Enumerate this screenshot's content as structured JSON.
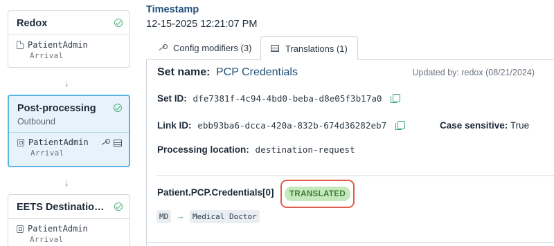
{
  "pipeline": [
    {
      "title": "Redox",
      "subtitle": "",
      "entity": "PatientAdmin",
      "event": "Arrival",
      "selected": false
    },
    {
      "title": "Post-processing",
      "subtitle": "Outbound",
      "entity": "PatientAdmin",
      "event": "Arrival",
      "selected": true
    },
    {
      "title": "EETS Destination ...",
      "subtitle": "",
      "entity": "PatientAdmin",
      "event": "Arrival",
      "selected": false
    }
  ],
  "arrow_glyph": "↓",
  "timestamp": {
    "label": "Timestamp",
    "value": "12-15-2025 12:21:07 PM"
  },
  "tabs": [
    {
      "label": "Config modifiers (3)",
      "icon": "wrench-icon",
      "active": false
    },
    {
      "label": "Translations (1)",
      "icon": "table-icon",
      "active": true
    }
  ],
  "set": {
    "name_label": "Set name:",
    "name_value": "PCP Credentials",
    "updated": "Updated by: redox (08/21/2024)",
    "set_id_label": "Set ID:",
    "set_id": "dfe7381f-4c94-4bd0-beba-d8e05f3b17a0",
    "link_id_label": "Link ID:",
    "link_id": "ebb93ba6-dcca-420a-832b-674d36282eb7",
    "case_label": "Case sensitive:",
    "case_value": "True",
    "location_label": "Processing location:",
    "location_value": "destination-request"
  },
  "translation": {
    "path": "Patient.PCP.Credentials[0]",
    "status": "TRANSLATED",
    "from": "MD",
    "arrow": "→",
    "to": "Medical Doctor"
  },
  "colors": {
    "accent": "#1f4e79",
    "selected_border": "#5bb3e4",
    "success": "#4caf7a",
    "highlight": "#e25c4b",
    "badge_bg": "#c5e8bd"
  }
}
